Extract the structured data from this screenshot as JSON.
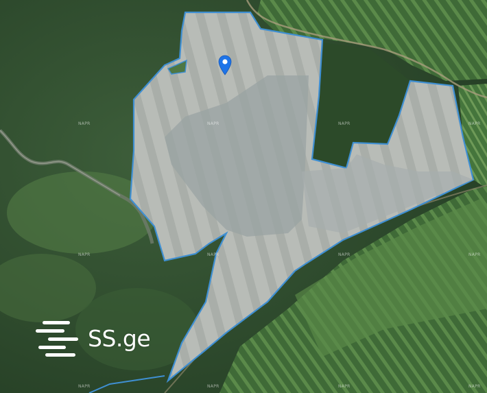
{
  "map": {
    "watermark": "NAPR",
    "parcel_stroke_color": "#3f8fd2",
    "marker_color": "#1e74e8",
    "marker_icon": "location-pin-icon"
  },
  "logo": {
    "text": "SS.ge",
    "icon": "ss-lines-icon"
  }
}
